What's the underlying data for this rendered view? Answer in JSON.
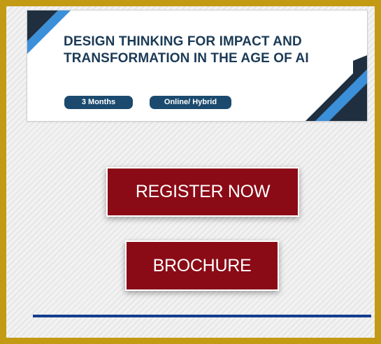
{
  "banner": {
    "title_line1": "DESIGN THINKING FOR IMPACT AND",
    "title_line2": "TRANSFORMATION IN THE AGE OF AI",
    "tags": [
      "3 Months",
      "Online/ Hybrid"
    ]
  },
  "actions": {
    "register_label": "REGISTER NOW",
    "brochure_label": "BROCHURE"
  },
  "colors": {
    "frame_border": "#c39a14",
    "button_bg": "#8a0b16",
    "title_text": "#1b3a56",
    "tag_bg": "#1b4a6e",
    "divider": "#163e8f",
    "accent_blue": "#3c8fd9",
    "accent_dark": "#1f2f3f"
  }
}
